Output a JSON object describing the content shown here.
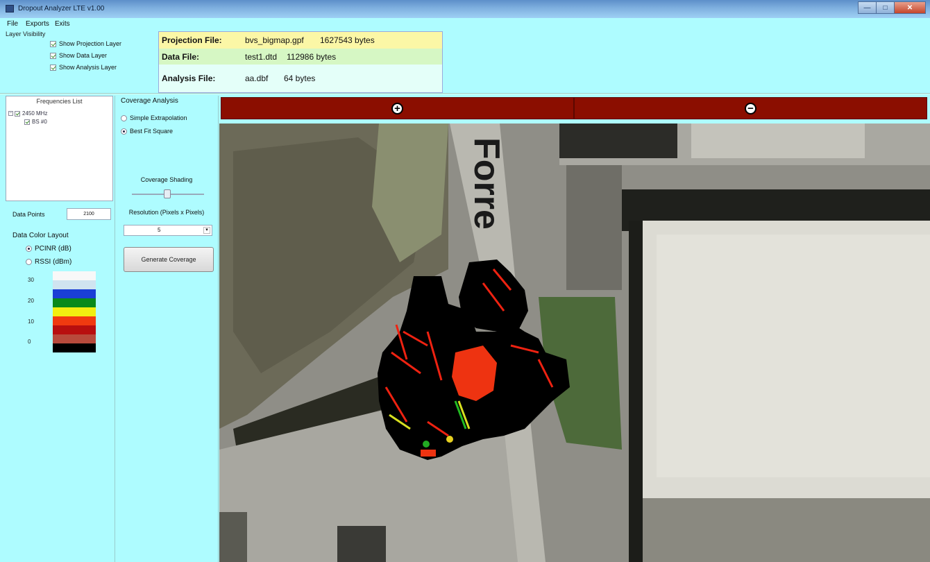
{
  "window": {
    "title": "Dropout Analyzer LTE v1.00"
  },
  "menu": [
    "File",
    "Exports",
    "Exits"
  ],
  "layer_visibility": {
    "label": "Layer Visibility",
    "items": [
      {
        "label": "Show Projection Layer",
        "checked": true
      },
      {
        "label": "Show Data Layer",
        "checked": true
      },
      {
        "label": "Show Analysis Layer",
        "checked": true
      }
    ]
  },
  "files": {
    "projection": {
      "label": "Projection File:",
      "name": "bvs_bigmap.gpf",
      "size": "1627543 bytes"
    },
    "data": {
      "label": "Data File:",
      "name": "test1.dtd",
      "size": "112986 bytes"
    },
    "analysis": {
      "label": "Analysis File:",
      "name": "aa.dbf",
      "size": "64 bytes"
    }
  },
  "frequencies": {
    "title": "Frequencies List",
    "items": [
      {
        "label": "2450 MHz",
        "level": 0
      },
      {
        "label": "BS #0",
        "level": 1
      }
    ]
  },
  "data_points": {
    "label": "Data Points",
    "value": "2100"
  },
  "color_layout": {
    "title": "Data Color Layout",
    "options": [
      {
        "label": "PCINR (dB)",
        "selected": true
      },
      {
        "label": "RSSI (dBm)",
        "selected": false
      }
    ],
    "scale_labels": [
      "30",
      "20",
      "10",
      "0"
    ],
    "swatches": [
      "#f8f8f8",
      "#d0e4f0",
      "#1a3fd6",
      "#0a8a1a",
      "#f2ee10",
      "#f03a10",
      "#b80f0f",
      "#b84a3c",
      "#000000"
    ]
  },
  "coverage": {
    "title": "Coverage Analysis",
    "options": [
      {
        "label": "Simple Extrapolation",
        "selected": false
      },
      {
        "label": "Best Fit Square",
        "selected": true
      }
    ],
    "shading_label": "Coverage Shading",
    "resolution_label": "Resolution (Pixels x Pixels)",
    "resolution_value": "5",
    "generate_label": "Generate Coverage"
  },
  "zoom": {
    "in": "+",
    "out": "−"
  },
  "map": {
    "street_text": "Forre"
  },
  "colors": {
    "zoom_bar": "#8b0e00",
    "panel_bg": "#aefcff"
  }
}
